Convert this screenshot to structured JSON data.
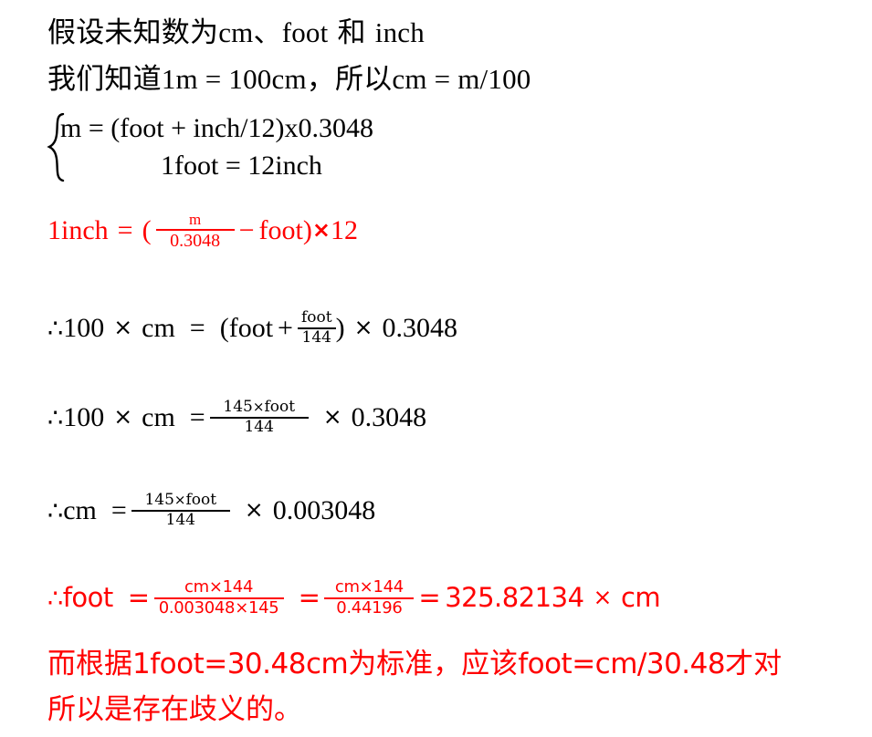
{
  "document": {
    "title_text_color": "#000000",
    "accent_color": "#ff0000",
    "background": "#ffffff"
  },
  "lines": {
    "l1": {
      "cjk_a": "假设未知数为",
      "lat_a": "cm",
      "cjk_b": "、",
      "lat_b": "foot",
      "cjk_c": " 和 ",
      "lat_c": "inch"
    },
    "l2": {
      "cjk_a": "我们知道",
      "lat_a": "1m = 100cm",
      "cjk_b": "，所以",
      "lat_b": "cm  =  m/100"
    },
    "eq_system": {
      "row1": "m  =  (foot + inch/12)x0.3048",
      "row2": "1foot = 12inch"
    },
    "eq_inch": {
      "lhs": "1inch",
      "eq": "=",
      "paren_open": "(",
      "frac_num": "m",
      "frac_den": "0.3048",
      "minus": "−",
      "foot": "foot",
      "paren_close": ")",
      "times": "×",
      "twelve": "12"
    },
    "eq_100cm_a": {
      "therefore": "∴",
      "lhs": "100",
      "times1": "×",
      "cm": "cm",
      "eq": "=",
      "paren_open": "(",
      "foot": "foot",
      "plus": "+",
      "frac_num": "foot",
      "frac_den": "144",
      "paren_close": ")",
      "times2": "×",
      "value": "0.3048"
    },
    "eq_100cm_b": {
      "therefore": "∴",
      "lhs": "100",
      "times1": "×",
      "cm": "cm",
      "eq": "=",
      "frac_num_a": "145",
      "frac_num_times": "×",
      "frac_num_b": "foot",
      "frac_den": "144",
      "times2": "×",
      "value": "0.3048"
    },
    "eq_cm": {
      "therefore": "∴",
      "cm": "cm",
      "eq": "=",
      "frac_num_a": "145",
      "frac_num_times": "×",
      "frac_num_b": "foot",
      "frac_den": "144",
      "times2": "×",
      "value": "0.003048"
    },
    "eq_foot": {
      "therefore": "∴",
      "foot": "foot",
      "eq1": "=",
      "frac1_num": "cm×144",
      "frac1_den": "0.003048×145",
      "eq2": "=",
      "frac2_num": "cm×144",
      "frac2_den": "0.44196",
      "eq3": "=",
      "value": "325.82134",
      "times": "×",
      "cm": "cm"
    },
    "concl1": {
      "cjk_a": "而根据",
      "lat_a": "1foot=30.48cm",
      "cjk_b": "为标准，应该",
      "lat_b": "foot=cm/30.48",
      "cjk_c": "才对"
    },
    "concl2": {
      "cjk_a": "所以是存在歧义的。"
    }
  }
}
